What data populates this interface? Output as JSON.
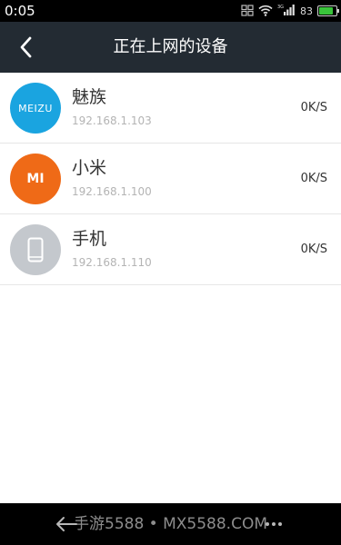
{
  "status_bar": {
    "time": "0:05",
    "battery_level": "83",
    "battery_fill": 0.83,
    "network_type": "3G",
    "icons": [
      "screenshot-icon",
      "wifi-icon",
      "signal-icon",
      "battery-icon"
    ],
    "colors": {
      "background": "#000000",
      "battery": "#39c43a"
    }
  },
  "header": {
    "title": "正在上网的设备",
    "back_icon": "chevron-left-icon",
    "colors": {
      "background": "#232b33",
      "text": "#ffffff"
    }
  },
  "devices": [
    {
      "name": "魅族",
      "ip": "192.168.1.103",
      "speed": "0K/S",
      "icon": "meizu-logo",
      "logo_text": "MEIZU",
      "color": "#1aa4e0"
    },
    {
      "name": "小米",
      "ip": "192.168.1.100",
      "speed": "0K/S",
      "icon": "mi-logo",
      "logo_text": "MI",
      "color": "#ef6a17"
    },
    {
      "name": "手机",
      "ip": "192.168.1.110",
      "speed": "0K/S",
      "icon": "phone-icon",
      "color": "#c4c8cd"
    }
  ],
  "bottom_bar": {
    "watermark": "手游5588 • MX5588.COM",
    "icons": [
      "back-arrow-icon",
      "menu-dots-icon"
    ]
  }
}
